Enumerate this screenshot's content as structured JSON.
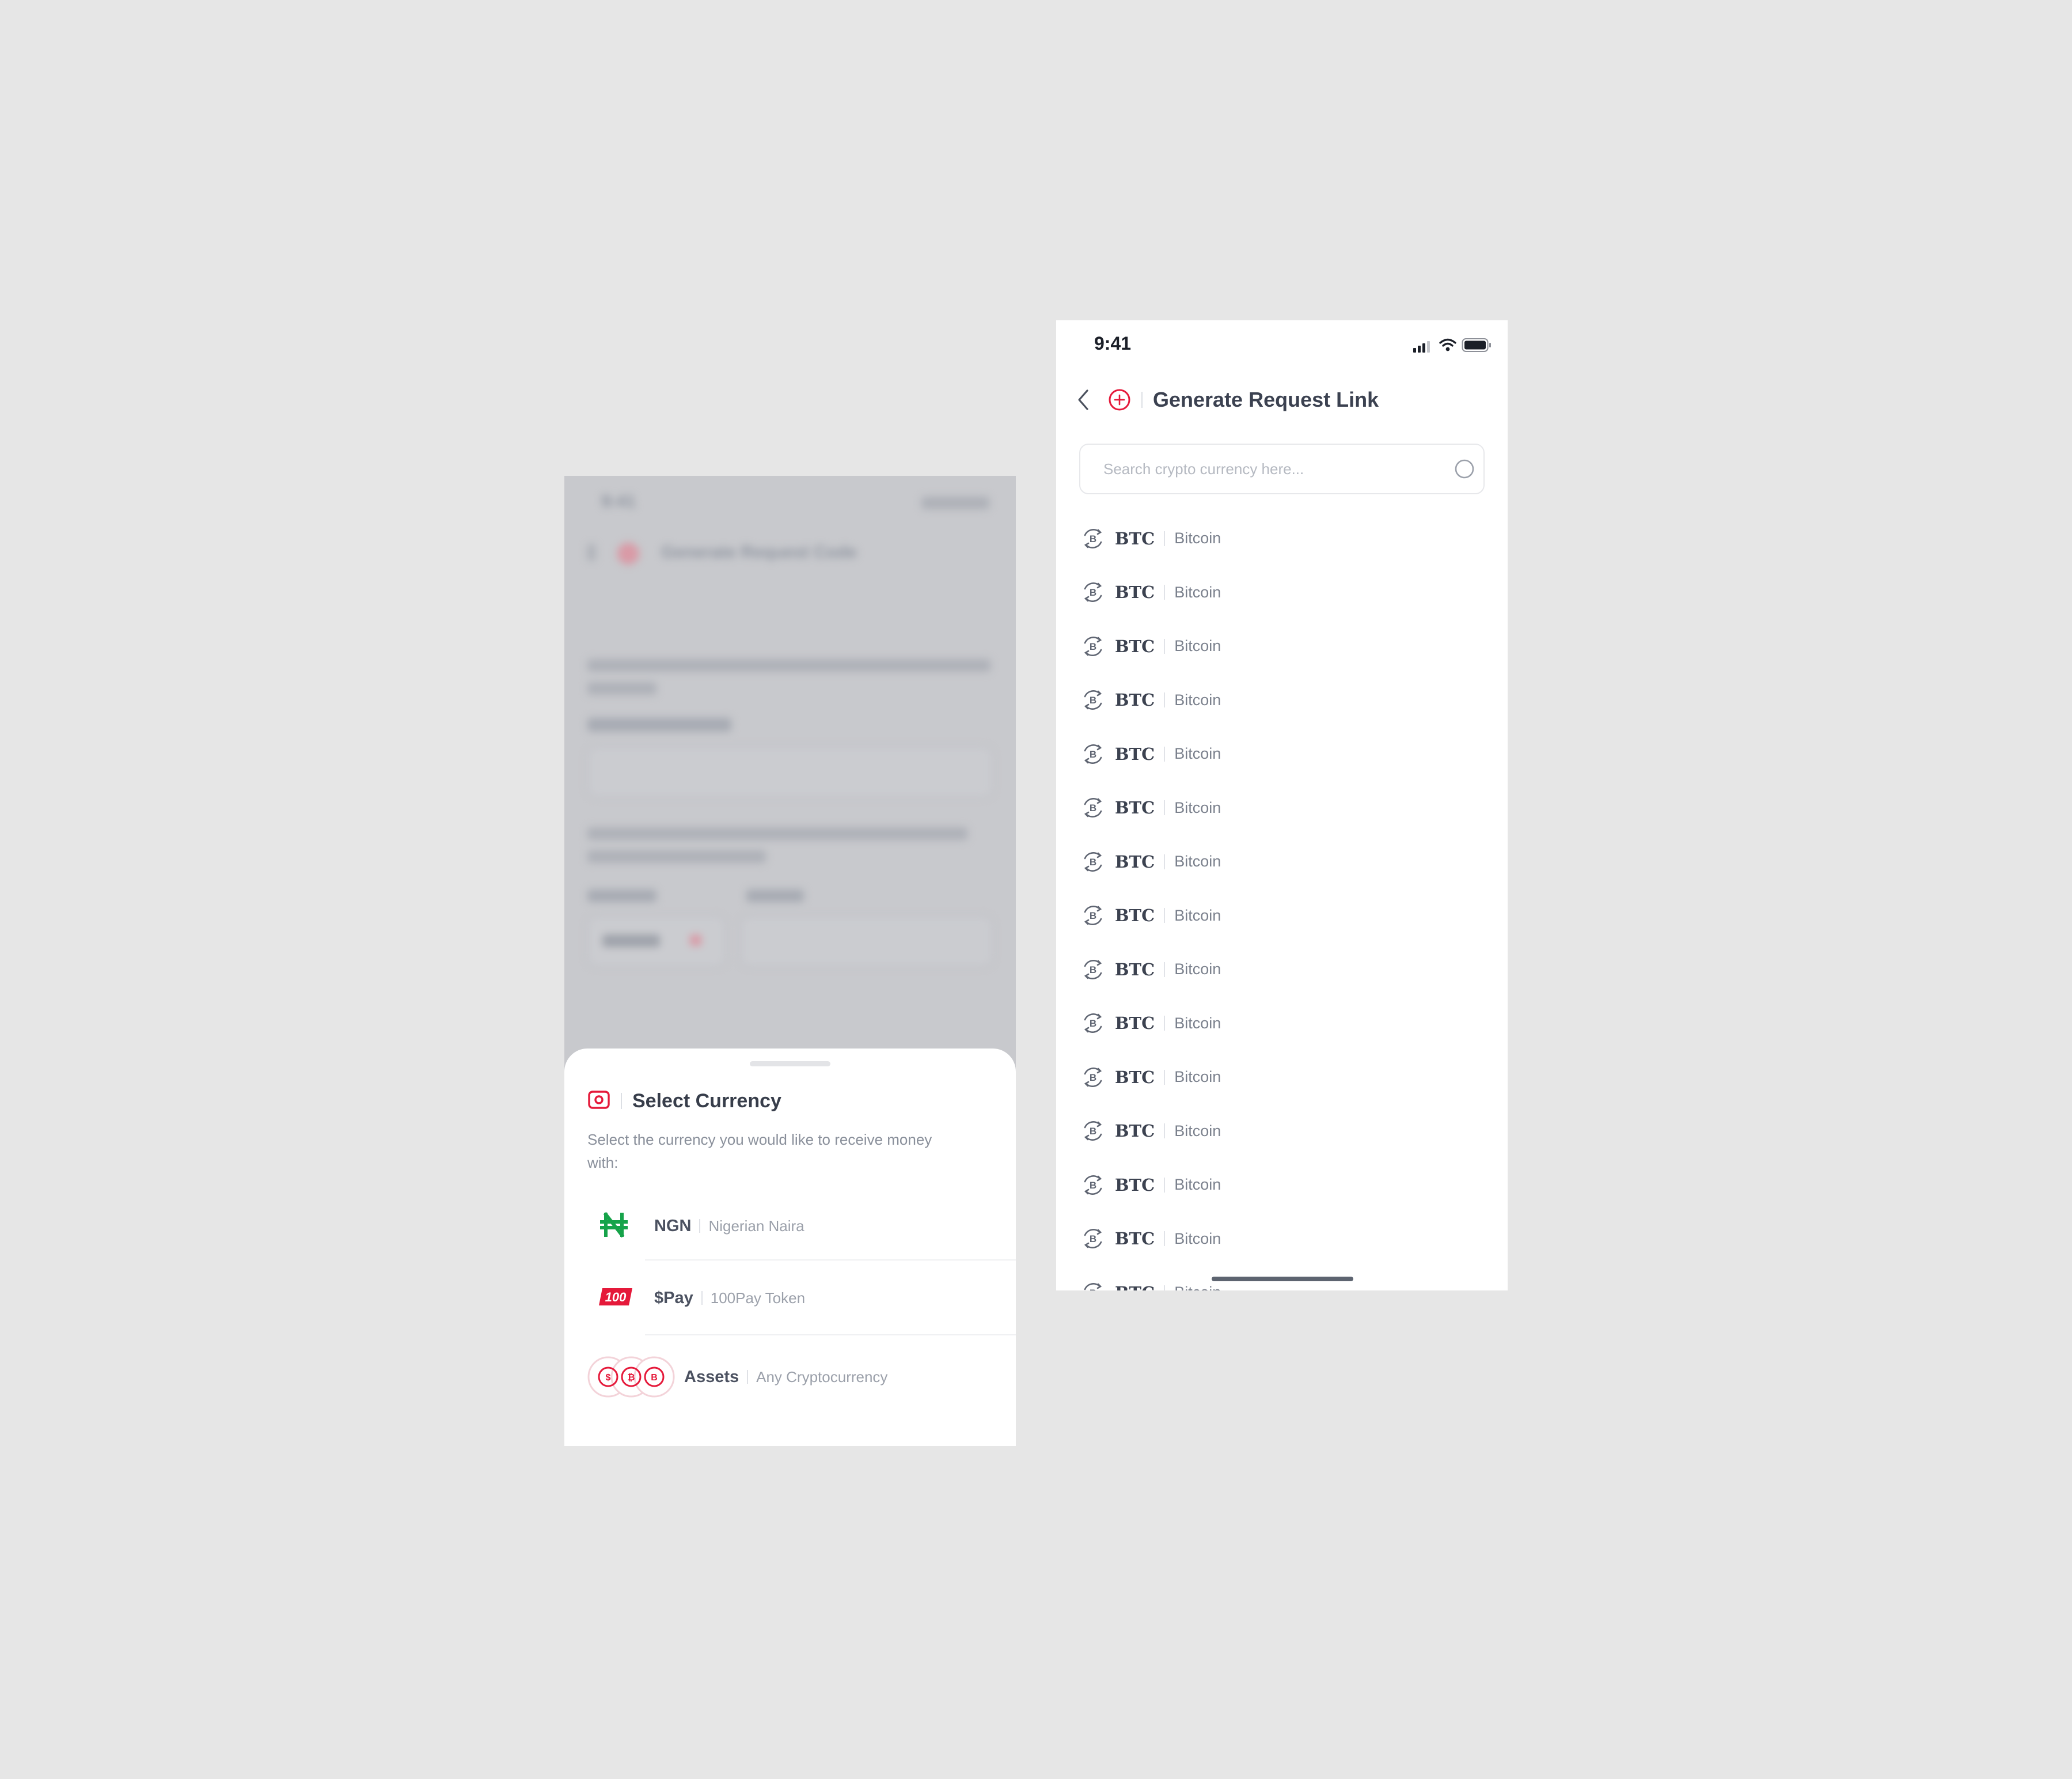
{
  "background_color": "#e6e6e6",
  "accent_color": "#e5193a",
  "left_screen": {
    "blurred_backdrop": {
      "time": "9:41",
      "title": "Generate Request Code"
    },
    "sheet": {
      "title": "Select Currency",
      "subtitle": "Select the currency you would like to receive money with:",
      "options": [
        {
          "code": "NGN",
          "name": "Nigerian Naira",
          "icon": "naira-icon",
          "icon_color": "#16a34a"
        },
        {
          "code": "$Pay",
          "name": "100Pay Token",
          "icon": "100pay-logo",
          "icon_color": "#e5193a"
        },
        {
          "code": "Assets",
          "name": "Any Cryptocurrency",
          "icon": "crypto-stack-icon",
          "icon_color": "#e5193a"
        }
      ]
    }
  },
  "right_screen": {
    "status_bar": {
      "time": "9:41"
    },
    "header": {
      "title": "Generate Request Link"
    },
    "search": {
      "placeholder": "Search crypto currency here..."
    },
    "currencies": [
      {
        "code": "BTC",
        "name": "Bitcoin"
      },
      {
        "code": "BTC",
        "name": "Bitcoin"
      },
      {
        "code": "BTC",
        "name": "Bitcoin"
      },
      {
        "code": "BTC",
        "name": "Bitcoin"
      },
      {
        "code": "BTC",
        "name": "Bitcoin"
      },
      {
        "code": "BTC",
        "name": "Bitcoin"
      },
      {
        "code": "BTC",
        "name": "Bitcoin"
      },
      {
        "code": "BTC",
        "name": "Bitcoin"
      },
      {
        "code": "BTC",
        "name": "Bitcoin"
      },
      {
        "code": "BTC",
        "name": "Bitcoin"
      },
      {
        "code": "BTC",
        "name": "Bitcoin"
      },
      {
        "code": "BTC",
        "name": "Bitcoin"
      },
      {
        "code": "BTC",
        "name": "Bitcoin"
      },
      {
        "code": "BTC",
        "name": "Bitcoin"
      },
      {
        "code": "BTC",
        "name": "Bitcoin"
      }
    ]
  }
}
